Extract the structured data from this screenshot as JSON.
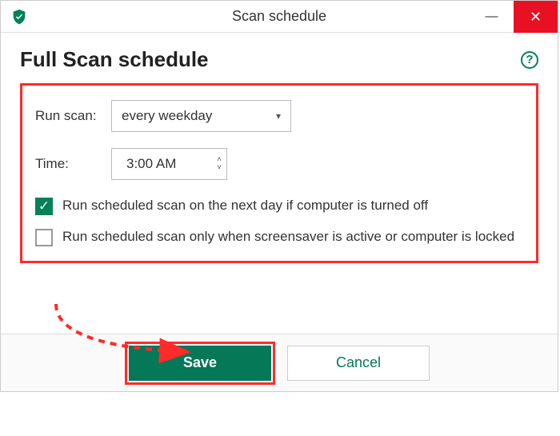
{
  "window": {
    "title": "Scan schedule"
  },
  "page": {
    "title": "Full Scan schedule"
  },
  "form": {
    "run_scan_label": "Run scan:",
    "run_scan_value": "every weekday",
    "time_label": "Time:",
    "time_value": "3:00 AM",
    "checkbox1": {
      "checked": true,
      "label": "Run scheduled scan on the next day if computer is turned off"
    },
    "checkbox2": {
      "checked": false,
      "label": "Run scheduled scan only when screensaver is active or computer is locked"
    }
  },
  "buttons": {
    "save": "Save",
    "cancel": "Cancel"
  },
  "icons": {
    "help": "?",
    "check": "✓",
    "chevron_down": "▾",
    "spin_up": "˄",
    "spin_down": "˅",
    "minimize": "—",
    "close": "✕"
  },
  "colors": {
    "brand": "#047857",
    "highlight": "#ff2a2a"
  }
}
